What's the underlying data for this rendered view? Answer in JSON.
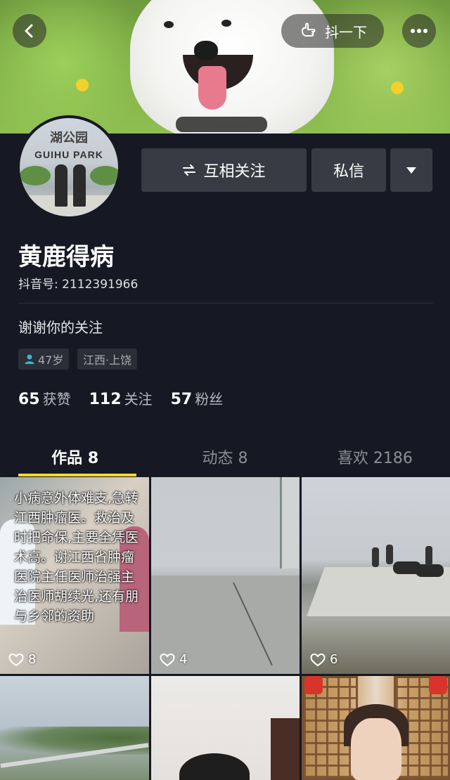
{
  "header": {
    "shake_label": "抖一下",
    "back_icon": "back-arrow-icon",
    "more_icon": "more-dots-icon"
  },
  "profile": {
    "avatar_sign_top": "湖公园",
    "avatar_sign": "GUIHU PARK",
    "name": "黄鹿得病",
    "douyin_id": "抖音号: 2112391966",
    "bio": "谢谢你的关注",
    "age_tag": "47岁",
    "location_tag": "江西·上饶"
  },
  "actions": {
    "follow_label": "互相关注",
    "message_label": "私信"
  },
  "stats": {
    "likes_num": "65",
    "likes_label": "获赞",
    "following_num": "112",
    "following_label": "关注",
    "followers_num": "57",
    "followers_label": "粉丝"
  },
  "tabs": [
    {
      "label": "作品 8"
    },
    {
      "label": "动态 8"
    },
    {
      "label": "喜欢 2186"
    }
  ],
  "videos": [
    {
      "likes": "8",
      "overlay": "小病意外体难支,急转江西肿瘤医。救治及时把命保,主要全凭医术高。谢江西省肿瘤医院主任医师治强主治医师胡续光,还有朋与乡邻的资助"
    },
    {
      "likes": "4"
    },
    {
      "likes": "6"
    },
    {
      "likes": ""
    },
    {
      "likes": ""
    },
    {
      "likes": ""
    }
  ],
  "colors": {
    "background": "#161823",
    "button": "#393b44",
    "accent_underline": "#fdd82f",
    "tag_icon": "#39b4d8"
  }
}
